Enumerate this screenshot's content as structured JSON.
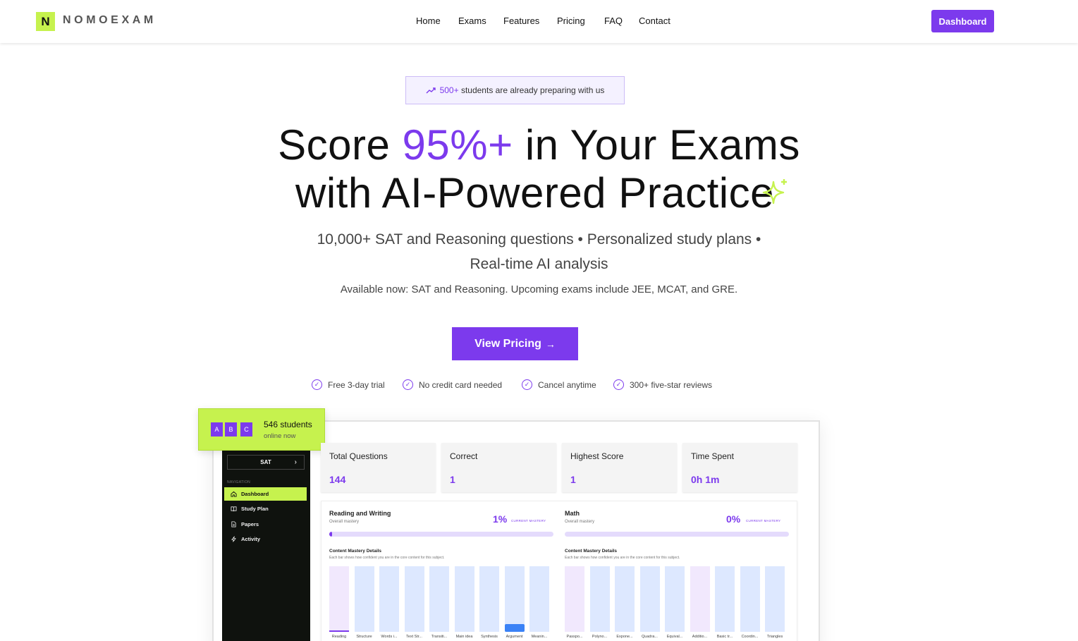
{
  "header": {
    "logo_letter": "N",
    "brand": "NOMOEXAM",
    "nav": [
      "Home",
      "Exams",
      "Features",
      "Pricing",
      "FAQ",
      "Contact"
    ],
    "dashboard_button": "Dashboard"
  },
  "hero": {
    "pill_count": "500+",
    "pill_text": "students are already preparing with us",
    "title_line1_pre": "Score ",
    "title_line1_accent": "95%+",
    "title_line1_post": " in Your Exams",
    "title_line2": "with AI-Powered Practice",
    "subtitle_line1": "10,000+ SAT and Reasoning questions • Personalized study plans •",
    "subtitle_line2": "Real-time AI analysis",
    "availability": "Available now: SAT and Reasoning. Upcoming exams include JEE, MCAT, and GRE.",
    "cta": "View Pricing",
    "cta_icon": "arrow-right-icon",
    "checks": [
      "Free 3-day trial",
      "No credit card needed",
      "Cancel anytime",
      "300+ five-star reviews"
    ]
  },
  "online_badge": {
    "avatars": [
      "A",
      "B",
      "C"
    ],
    "count": "546 students",
    "sub": "online now"
  },
  "app": {
    "exam_select": "SAT",
    "nav_title": "NAVIGATION",
    "nav_items": [
      {
        "label": "Dashboard",
        "icon": "home-icon",
        "active": true
      },
      {
        "label": "Study Plan",
        "icon": "book-open-icon",
        "active": false
      },
      {
        "label": "Papers",
        "icon": "file-text-icon",
        "active": false
      },
      {
        "label": "Activity",
        "icon": "zap-icon",
        "active": false
      }
    ],
    "stats": [
      {
        "label": "Total Questions",
        "value": "144"
      },
      {
        "label": "Correct",
        "value": "1"
      },
      {
        "label": "Highest Score",
        "value": "1"
      },
      {
        "label": "Time Spent",
        "value": "0h 1m"
      }
    ],
    "subjects": [
      {
        "title": "Reading and Writing",
        "meta": "Overall mastery",
        "pct": "1%",
        "pct_label": "CURRENT MASTERY",
        "progress": 0.01,
        "detail_title": "Content Mastery Details",
        "detail_meta": "Each bar shows how confident you are in the core content for this subject.",
        "bars": [
          {
            "label": "Reading",
            "fill": 0.02,
            "pink": true
          },
          {
            "label": "Structure",
            "fill": 0,
            "pink": false
          },
          {
            "label": "Words i...",
            "fill": 0,
            "pink": false
          },
          {
            "label": "Text Str...",
            "fill": 0,
            "pink": false
          },
          {
            "label": "Transiti...",
            "fill": 0,
            "pink": false
          },
          {
            "label": "Main idea",
            "fill": 0,
            "pink": false
          },
          {
            "label": "Synthesis",
            "fill": 0,
            "pink": false
          },
          {
            "label": "Argument",
            "fill": 0.12,
            "pink": false
          },
          {
            "label": "Meanin...",
            "fill": 0,
            "pink": false
          }
        ]
      },
      {
        "title": "Math",
        "meta": "Overall mastery",
        "pct": "0%",
        "pct_label": "CURRENT MASTERY",
        "progress": 0,
        "detail_title": "Content Mastery Details",
        "detail_meta": "Each bar shows how confident you are in the core content for this subject.",
        "bars": [
          {
            "label": "Passpo...",
            "fill": 0,
            "pink": true
          },
          {
            "label": "Polyno...",
            "fill": 0,
            "pink": false
          },
          {
            "label": "Expone...",
            "fill": 0,
            "pink": false
          },
          {
            "label": "Quadra...",
            "fill": 0,
            "pink": false
          },
          {
            "label": "Equival...",
            "fill": 0,
            "pink": false
          },
          {
            "label": "Additio...",
            "fill": 0,
            "pink": true
          },
          {
            "label": "Basic tr...",
            "fill": 0,
            "pink": false
          },
          {
            "label": "Coordin...",
            "fill": 0,
            "pink": false
          },
          {
            "label": "Triangles",
            "fill": 0,
            "pink": false
          }
        ]
      }
    ]
  },
  "colors": {
    "accent": "#7c3aed",
    "lime": "#c6f24e",
    "sidebar": "#0f120e",
    "bar_blue": "#3b82f6"
  }
}
